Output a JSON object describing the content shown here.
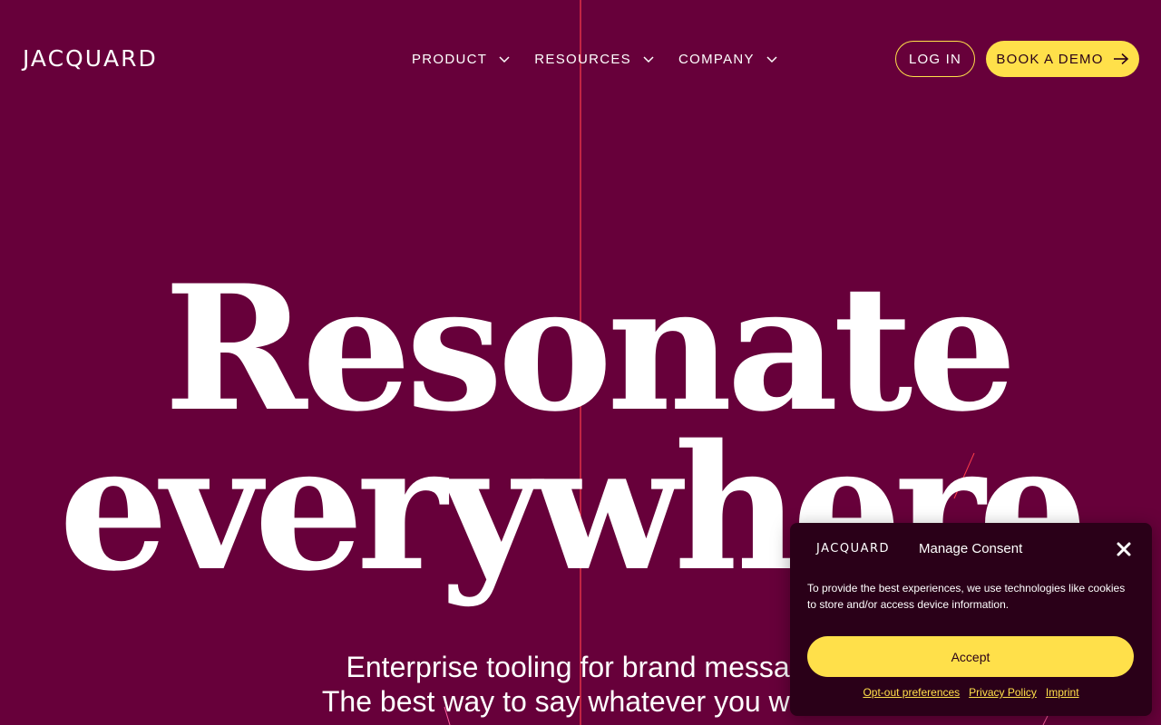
{
  "brand": {
    "logo_text": "JACQUARD",
    "accent": "#ffe04a",
    "background": "#67003a"
  },
  "nav": {
    "items": [
      {
        "label": "PRODUCT"
      },
      {
        "label": "RESOURCES"
      },
      {
        "label": "COMPANY"
      }
    ]
  },
  "header": {
    "login_label": "LOG IN",
    "demo_label": "BOOK A DEMO"
  },
  "hero": {
    "line1": "Resonate",
    "line2": "everywhere",
    "sub1": "Enterprise tooling for brand messag",
    "sub2": "The best way to say whatever you want"
  },
  "consent": {
    "logo_text": "JACQUARD",
    "title": "Manage Consent",
    "text": "To provide the best experiences, we use technologies like cookies to store and/or access device information.",
    "accept_label": "Accept",
    "links": [
      "Opt-out preferences",
      "Privacy Policy",
      "Imprint"
    ],
    "background": "#2a0018"
  }
}
